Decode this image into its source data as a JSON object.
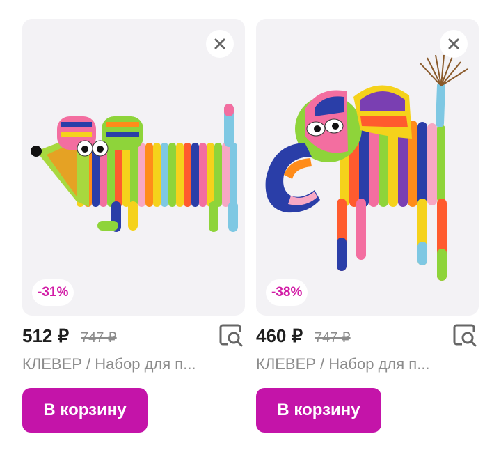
{
  "products": [
    {
      "discount": "-31%",
      "price": "512 ₽",
      "old_price": "747 ₽",
      "title": "КЛЕВЕР / Набор для п...",
      "cart_label": "В корзину",
      "close_icon": "close-icon",
      "similar_icon": "search-similar-icon"
    },
    {
      "discount": "-38%",
      "price": "460 ₽",
      "old_price": "747 ₽",
      "title": "КЛЕВЕР / Набор для п...",
      "cart_label": "В корзину",
      "close_icon": "close-icon",
      "similar_icon": "search-similar-icon"
    }
  ],
  "colors": {
    "accent": "#c414a9",
    "badge_text": "#d21ca6",
    "card_bg": "#f3f2f5"
  }
}
